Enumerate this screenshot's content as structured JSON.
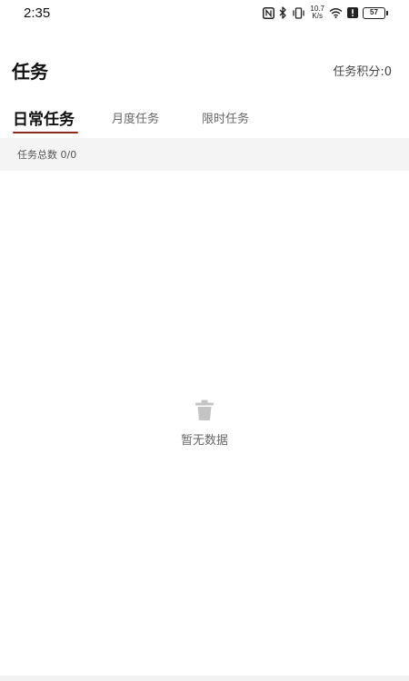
{
  "status_bar": {
    "time": "2:35",
    "net_speed_value": "10.7",
    "net_speed_unit": "K/s",
    "battery": "57",
    "icons": [
      "nfc-icon",
      "bluetooth-icon",
      "vibrate-icon",
      "wifi-icon",
      "alert-icon",
      "battery-icon"
    ]
  },
  "header": {
    "title": "任务",
    "score_label": "任务积分:0"
  },
  "tabs": [
    {
      "label": "日常任务",
      "active": true
    },
    {
      "label": "月度任务",
      "active": false
    },
    {
      "label": "限时任务",
      "active": false
    }
  ],
  "colors": {
    "tab_indicator": "#8a2a22",
    "summary_background": "#f4f4f4"
  },
  "summary": {
    "text": "任务总数 0/0"
  },
  "empty_state": {
    "icon": "trash-icon",
    "text": "暂无数据"
  }
}
